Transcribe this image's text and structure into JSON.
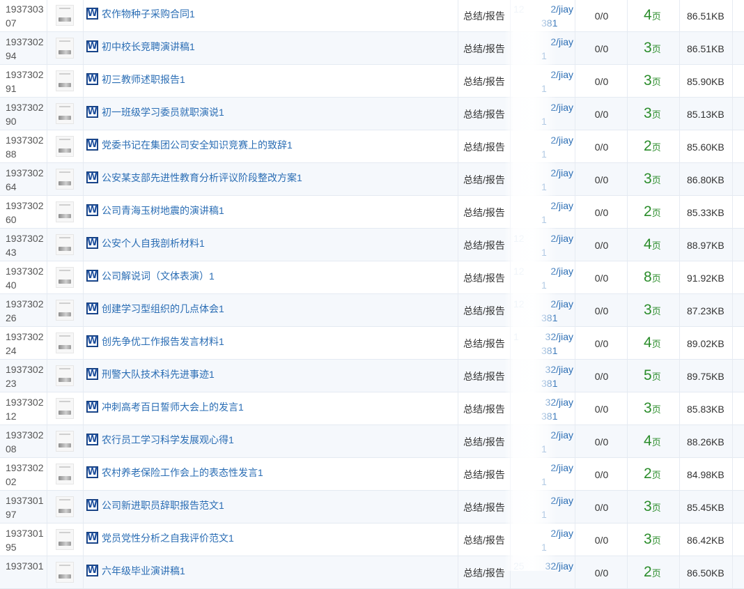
{
  "table": {
    "page_unit": "页",
    "rows": [
      {
        "id": "193730307",
        "title": "农作物种子采购合同1",
        "category": "总结/报告",
        "path_1": "12",
        "path_2": "2/jiay",
        "path_3": "381",
        "count": "0/0",
        "pages": "4",
        "size": "86.51KB"
      },
      {
        "id": "193730294",
        "title": "初中校长竞聘演讲稿1",
        "category": "总结/报告",
        "path_1": "",
        "path_2": "2/jiay",
        "path_3": "1",
        "count": "0/0",
        "pages": "3",
        "size": "86.51KB"
      },
      {
        "id": "193730291",
        "title": "初三教师述职报告1",
        "category": "总结/报告",
        "path_1": "",
        "path_2": "2/jiay",
        "path_3": "1",
        "count": "0/0",
        "pages": "3",
        "size": "85.90KB"
      },
      {
        "id": "193730290",
        "title": "初一班级学习委员就职演说1",
        "category": "总结/报告",
        "path_1": "",
        "path_2": "2/jiay",
        "path_3": "1",
        "count": "0/0",
        "pages": "3",
        "size": "85.13KB"
      },
      {
        "id": "193730288",
        "title": "党委书记在集团公司安全知识竞赛上的致辞1",
        "category": "总结/报告",
        "path_1": "",
        "path_2": "2/jiay",
        "path_3": "1",
        "count": "0/0",
        "pages": "2",
        "size": "85.60KB"
      },
      {
        "id": "193730264",
        "title": "公安某支部先进性教育分析评议阶段整改方案1",
        "category": "总结/报告",
        "path_1": "",
        "path_2": "2/jiay",
        "path_3": "1",
        "count": "0/0",
        "pages": "3",
        "size": "86.80KB"
      },
      {
        "id": "193730260",
        "title": "公司青海玉树地震的演讲稿1",
        "category": "总结/报告",
        "path_1": "",
        "path_2": "2/jiay",
        "path_3": "1",
        "count": "0/0",
        "pages": "2",
        "size": "85.33KB"
      },
      {
        "id": "193730243",
        "title": "公安个人自我剖析材料1",
        "category": "总结/报告",
        "path_1": "12",
        "path_2": "2/jiay",
        "path_3": "1",
        "count": "0/0",
        "pages": "4",
        "size": "88.97KB"
      },
      {
        "id": "193730240",
        "title": "公司解说词（文体表演）1",
        "category": "总结/报告",
        "path_1": "12",
        "path_2": "2/jiay",
        "path_3": "1",
        "count": "0/0",
        "pages": "8",
        "size": "91.92KB"
      },
      {
        "id": "193730226",
        "title": "创建学习型组织的几点体会1",
        "category": "总结/报告",
        "path_1": "12",
        "path_2": "2/jiay",
        "path_3": "381",
        "count": "0/0",
        "pages": "3",
        "size": "87.23KB"
      },
      {
        "id": "193730224",
        "title": "创先争优工作报告发言材料1",
        "category": "总结/报告",
        "path_1": "1",
        "path_2": "32/jiay",
        "path_3": "381",
        "count": "0/0",
        "pages": "4",
        "size": "89.02KB"
      },
      {
        "id": "193730223",
        "title": "刑警大队技术科先进事迹1",
        "category": "总结/报告",
        "path_1": "",
        "path_2": "32/jiay",
        "path_3": "381",
        "count": "0/0",
        "pages": "5",
        "size": "89.75KB"
      },
      {
        "id": "193730212",
        "title": "冲刺高考百日誓师大会上的发言1",
        "category": "总结/报告",
        "path_1": "",
        "path_2": "32/jiay",
        "path_3": "381",
        "count": "0/0",
        "pages": "3",
        "size": "85.83KB"
      },
      {
        "id": "193730208",
        "title": "农行员工学习科学发展观心得1",
        "category": "总结/报告",
        "path_1": "",
        "path_2": "2/jiay",
        "path_3": "1",
        "count": "0/0",
        "pages": "4",
        "size": "88.26KB"
      },
      {
        "id": "193730202",
        "title": "农村养老保险工作会上的表态性发言1",
        "category": "总结/报告",
        "path_1": "",
        "path_2": "2/jiay",
        "path_3": "1",
        "count": "0/0",
        "pages": "2",
        "size": "84.98KB"
      },
      {
        "id": "193730197",
        "title": "公司新进职员辞职报告范文1",
        "category": "总结/报告",
        "path_1": "",
        "path_2": "2/jiay",
        "path_3": "1",
        "count": "0/0",
        "pages": "3",
        "size": "85.45KB"
      },
      {
        "id": "193730195",
        "title": "党员党性分析之自我评价范文1",
        "category": "总结/报告",
        "path_1": "",
        "path_2": "2/jiay",
        "path_3": "1",
        "count": "0/0",
        "pages": "3",
        "size": "86.42KB"
      },
      {
        "id": "1937301",
        "title": "六年级毕业演讲稿1",
        "category": "总结/报告",
        "path_1": "25",
        "path_2": "32/jiay",
        "path_3": "",
        "count": "0/0",
        "pages": "2",
        "size": "86.50KB"
      }
    ]
  }
}
